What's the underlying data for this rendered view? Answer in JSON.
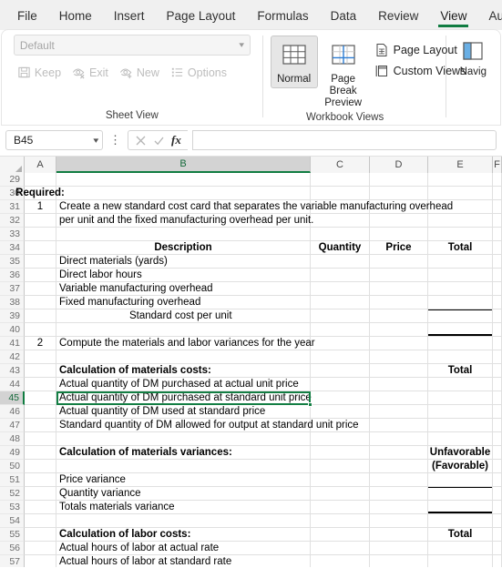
{
  "ribbon": {
    "tabs": [
      {
        "label": "File",
        "active": false
      },
      {
        "label": "Home",
        "active": false
      },
      {
        "label": "Insert",
        "active": false
      },
      {
        "label": "Page Layout",
        "active": false
      },
      {
        "label": "Formulas",
        "active": false
      },
      {
        "label": "Data",
        "active": false
      },
      {
        "label": "Review",
        "active": false
      },
      {
        "label": "View",
        "active": true
      },
      {
        "label": "Automat",
        "active": false
      }
    ],
    "accent_color": "#107c41",
    "groups": {
      "sheet_view": {
        "label": "Sheet View",
        "combo_value": "Default",
        "buttons": [
          {
            "label": "Keep",
            "icon": "save-icon",
            "disabled": true
          },
          {
            "label": "Exit",
            "icon": "eye-exit-icon",
            "disabled": true
          },
          {
            "label": "New",
            "icon": "eye-new-icon",
            "disabled": true
          },
          {
            "label": "Options",
            "icon": "options-list-icon",
            "disabled": true
          }
        ]
      },
      "workbook_views": {
        "label": "Workbook Views",
        "big_buttons": [
          {
            "label": "Normal",
            "icon": "normal-view-icon",
            "selected": true
          },
          {
            "label": "Page Break Preview",
            "icon": "page-break-preview-icon",
            "selected": false
          }
        ],
        "small_buttons": [
          {
            "label": "Page Layout",
            "icon": "page-layout-icon"
          },
          {
            "label": "Custom Views",
            "icon": "custom-views-icon"
          }
        ]
      },
      "navigation": {
        "label": "Navig",
        "icon": "navigation-icon"
      }
    }
  },
  "formula_bar": {
    "name_box_value": "B45",
    "formula_value": "",
    "cancel_icon": "cancel-x-icon",
    "enter_icon": "enter-check-icon",
    "function_icon": "insert-function-fx-icon",
    "more_icon": "more-vertical-dots-icon"
  },
  "grid": {
    "columns": [
      {
        "label": "A",
        "selected": false
      },
      {
        "label": "B",
        "selected": true
      },
      {
        "label": "C",
        "selected": false
      },
      {
        "label": "D",
        "selected": false
      },
      {
        "label": "E",
        "selected": false
      },
      {
        "label": "F",
        "selected": false
      }
    ],
    "selected_cell": "B45",
    "rows": [
      {
        "n": "29",
        "a": "",
        "b": "",
        "c": "",
        "d": "",
        "e": ""
      },
      {
        "n": "30",
        "a": "Required:",
        "a_bold": true,
        "a_spill": true,
        "b": "",
        "c": "",
        "d": "",
        "e": ""
      },
      {
        "n": "31",
        "a": "1",
        "b": "Create a new standard cost card that separates the variable manufacturing overhead",
        "b_spill": true,
        "c": "",
        "d": "",
        "e": ""
      },
      {
        "n": "32",
        "a": "",
        "b": "per unit and the fixed manufacturing overhead per unit.",
        "b_spill": true,
        "c": "",
        "d": "",
        "e": ""
      },
      {
        "n": "33",
        "a": "",
        "b": "",
        "c": "",
        "d": "",
        "e": ""
      },
      {
        "n": "34",
        "a": "",
        "b": "Description",
        "b_bold": true,
        "b_center": true,
        "c": "Quantity",
        "c_bold": true,
        "d": "Price",
        "d_bold": true,
        "e": "Total",
        "e_bold": true
      },
      {
        "n": "35",
        "a": "",
        "b": "Direct materials (yards)",
        "c": "",
        "d": "",
        "e": ""
      },
      {
        "n": "36",
        "a": "",
        "b": "Direct labor hours",
        "c": "",
        "d": "",
        "e": ""
      },
      {
        "n": "37",
        "a": "",
        "b": "Variable manufacturing overhead",
        "c": "",
        "d": "",
        "e": ""
      },
      {
        "n": "38",
        "a": "",
        "b": "Fixed manufacturing overhead",
        "c": "",
        "d": "",
        "e": ""
      },
      {
        "n": "39",
        "a": "",
        "b": "Standard cost per unit",
        "b_indent": true,
        "c": "",
        "d": "",
        "e": "",
        "e_border": "top"
      },
      {
        "n": "40",
        "a": "",
        "b": "",
        "c": "",
        "d": "",
        "e": "",
        "e_border": "double"
      },
      {
        "n": "41",
        "a": "2",
        "b": "Compute the materials and labor variances for the year",
        "b_spill": true,
        "c": "",
        "d": "",
        "e": ""
      },
      {
        "n": "42",
        "a": "",
        "b": "",
        "c": "",
        "d": "",
        "e": ""
      },
      {
        "n": "43",
        "a": "",
        "b": "Calculation of materials costs:",
        "b_bold": true,
        "c": "",
        "d": "",
        "e": "Total",
        "e_bold": true
      },
      {
        "n": "44",
        "a": "",
        "b": "Actual quantity of DM purchased at actual unit price",
        "b_spill": true,
        "c": "",
        "d": "",
        "e": ""
      },
      {
        "n": "45",
        "a": "",
        "b": "Actual quantity of DM purchased at standard unit price",
        "b_spill": true,
        "selected": true,
        "c": "",
        "d": "",
        "e": ""
      },
      {
        "n": "46",
        "a": "",
        "b": "Actual quantity of DM used at standard price",
        "b_spill": true,
        "c": "",
        "d": "",
        "e": ""
      },
      {
        "n": "47",
        "a": "",
        "b": "Standard quantity of DM allowed for output at standard unit price",
        "b_spill": true,
        "c": "",
        "d": "",
        "e": ""
      },
      {
        "n": "48",
        "a": "",
        "b": "",
        "c": "",
        "d": "",
        "e": ""
      },
      {
        "n": "49",
        "a": "",
        "b": "Calculation of materials variances:",
        "b_bold": true,
        "c": "",
        "d": "",
        "e": "Unfavorable",
        "e_bold": true
      },
      {
        "n": "50",
        "a": "",
        "b": "",
        "c": "",
        "d": "",
        "e": "(Favorable)",
        "e_bold": true
      },
      {
        "n": "51",
        "a": "",
        "b": "Price variance",
        "c": "",
        "d": "",
        "e": ""
      },
      {
        "n": "52",
        "a": "",
        "b": "Quantity variance",
        "c": "",
        "d": "",
        "e": "",
        "e_border": "top"
      },
      {
        "n": "53",
        "a": "",
        "b": "Totals materials variance",
        "c": "",
        "d": "",
        "e": "",
        "e_border": "double"
      },
      {
        "n": "54",
        "a": "",
        "b": "",
        "c": "",
        "d": "",
        "e": ""
      },
      {
        "n": "55",
        "a": "",
        "b": "Calculation of labor costs:",
        "b_bold": true,
        "c": "",
        "d": "",
        "e": "Total",
        "e_bold": true
      },
      {
        "n": "56",
        "a": "",
        "b": "Actual hours of labor at actual rate",
        "b_spill": true,
        "c": "",
        "d": "",
        "e": ""
      },
      {
        "n": "57",
        "a": "",
        "b": "Actual hours of labor at standard rate",
        "b_spill": true,
        "c": "",
        "d": "",
        "e": ""
      }
    ]
  }
}
